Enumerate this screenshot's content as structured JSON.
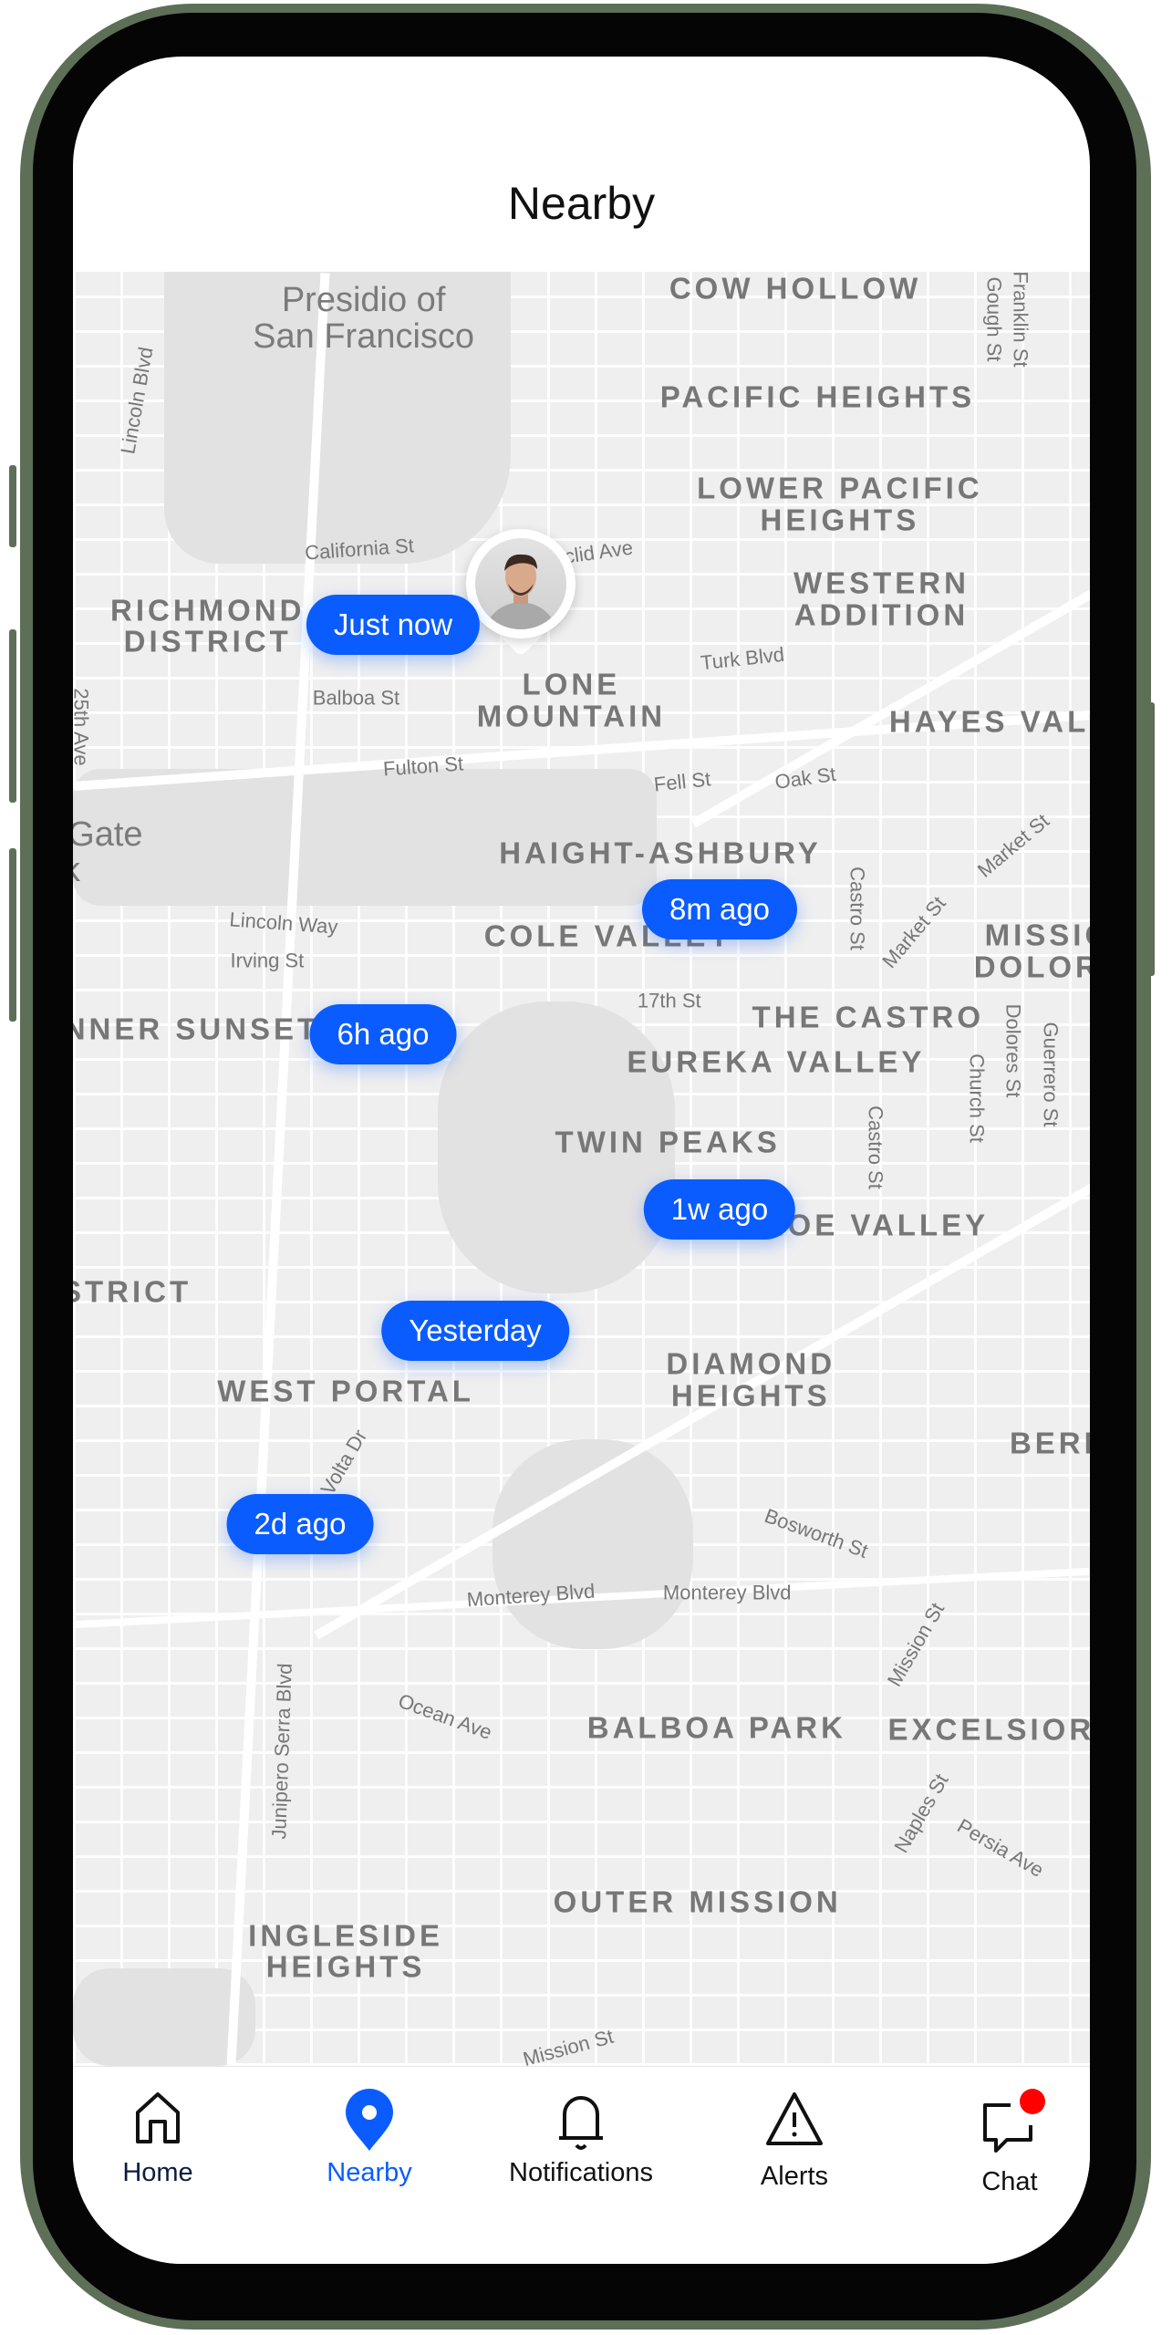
{
  "header": {
    "title": "Nearby"
  },
  "map": {
    "labels": [
      "Presidio of\nSan Francisco",
      "COW HOLLOW",
      "PACIFIC HEIGHTS",
      "LOWER PACIFIC\nHEIGHTS",
      "WESTERN\nADDITION",
      "RICHMOND\nDISTRICT",
      "LONE\nMOUNTAIN",
      "HAYES VALLEY",
      "HAIGHT-ASHBURY",
      "COLE VALLEY",
      "MISSION\nDOLORES",
      "THE CASTRO",
      "EUREKA VALLEY",
      "INNER SUNSET",
      "TWIN PEAKS",
      "NOE VALLEY",
      "SUNSET DISTRICT",
      "WEST PORTAL",
      "DIAMOND\nHEIGHTS",
      "BERNAL",
      "BALBOA PARK",
      "EXCELSIOR",
      "OUTER MISSION",
      "INGLESIDE\nHEIGHTS",
      "Golden Gate\nPark",
      "California St",
      "Euclid Ave",
      "Turk Blvd",
      "Balboa St",
      "Fulton St",
      "Fell St",
      "Oak St",
      "Lincoln Way",
      "Irving St",
      "17th St",
      "Monterey Blvd",
      "Monterey Blvd",
      "Ocean Ave",
      "Lincoln Blvd",
      "25th Ave",
      "Castro St",
      "Market St",
      "Market St",
      "Dolores St",
      "Church St",
      "Guerrero St",
      "Castro St",
      "Junipero Serra Blvd",
      "Bosworth St",
      "Mission St",
      "Naples St",
      "Persia Ave",
      "Franklin St",
      "Gough St",
      "Mission St",
      "Volta Dr"
    ],
    "user_pin": {
      "icon": "user-avatar-pin"
    },
    "pills": [
      "Just now",
      "8m ago",
      "6h ago",
      "1w ago",
      "Yesterday",
      "2d ago"
    ],
    "pill_color": "#0a5cff"
  },
  "tabbar": {
    "active": "Nearby",
    "active_color": "#0a5cff",
    "badge_color": "#ff0000",
    "items": [
      {
        "label": "Home",
        "icon": "home-icon"
      },
      {
        "label": "Nearby",
        "icon": "location-pin-icon"
      },
      {
        "label": "Notifications",
        "icon": "bell-icon"
      },
      {
        "label": "Alerts",
        "icon": "warning-triangle-icon"
      },
      {
        "label": "Chat",
        "icon": "chat-bubble-icon"
      }
    ]
  }
}
